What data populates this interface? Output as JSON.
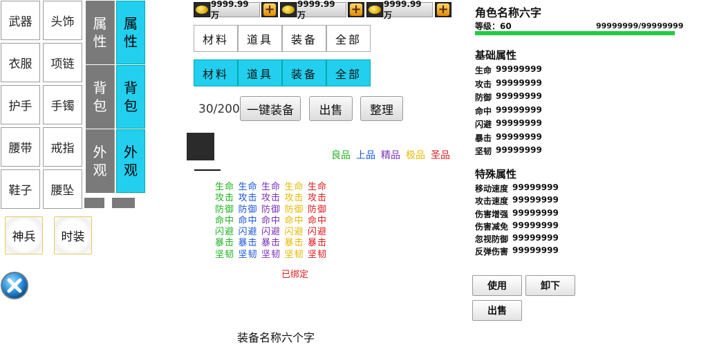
{
  "slots": [
    {
      "name": "weapon",
      "label": "武器"
    },
    {
      "name": "headwear",
      "label": "头饰"
    },
    {
      "name": "clothes",
      "label": "衣服"
    },
    {
      "name": "necklace",
      "label": "项链"
    },
    {
      "name": "wristguard",
      "label": "护手"
    },
    {
      "name": "bracelet",
      "label": "手镯"
    },
    {
      "name": "belt",
      "label": "腰带"
    },
    {
      "name": "ring",
      "label": "戒指"
    },
    {
      "name": "shoes",
      "label": "鞋子"
    },
    {
      "name": "pendant",
      "label": "腰坠"
    }
  ],
  "vtabs_left": [
    "属性",
    "背包",
    "外观"
  ],
  "vtabs_right": [
    "属性",
    "背包",
    "外观"
  ],
  "round_buttons": [
    "神兵",
    "时装"
  ],
  "currency": [
    "9999.99万",
    "9999.99万",
    "9999.99万"
  ],
  "filter_tabs": [
    "材料",
    "道具",
    "装备",
    "全部"
  ],
  "bag": {
    "capacity": "30/200",
    "equip_all": "一键装备",
    "sell": "出售",
    "sort": "整理"
  },
  "qualities": [
    {
      "label": "良品",
      "color": "#1db31d"
    },
    {
      "label": "上品",
      "color": "#1a56e0"
    },
    {
      "label": "精品",
      "color": "#7a2fb8"
    },
    {
      "label": "极品",
      "color": "#e6b800"
    },
    {
      "label": "圣品",
      "color": "#e01a1a"
    }
  ],
  "stat_colors": [
    "#1db31d",
    "#1a56e0",
    "#7a2fb8",
    "#e6b800",
    "#e01a1a"
  ],
  "stat_rows": [
    [
      "生命",
      "生命",
      "生命",
      "生命",
      "生命"
    ],
    [
      "攻击",
      "攻击",
      "攻击",
      "攻击",
      "攻击"
    ],
    [
      "防御",
      "防御",
      "防御",
      "防御",
      "防御"
    ],
    [
      "命中",
      "命中",
      "命中",
      "命中",
      "命中"
    ],
    [
      "闪避",
      "闪避",
      "闪避",
      "闪避",
      "闪避"
    ],
    [
      "暴击",
      "暴击",
      "暴击",
      "暴击",
      "暴击"
    ],
    [
      "坚韧",
      "坚韧",
      "坚韧",
      "坚韧",
      "坚韧"
    ]
  ],
  "bound_text": "已绑定",
  "bound_color": "#e01a1a",
  "equip_name": "装备名称六个字",
  "character": {
    "name": "角色名称六字",
    "level": "等级：60",
    "exp": "99999999/99999999",
    "exp_progress": 1.0,
    "exp_color": "#22cc44",
    "base_title": "基础属性",
    "base": [
      {
        "k": "生命",
        "v": "99999999"
      },
      {
        "k": "攻击",
        "v": "99999999"
      },
      {
        "k": "防御",
        "v": "99999999"
      },
      {
        "k": "命中",
        "v": "99999999"
      },
      {
        "k": "闪避",
        "v": "99999999"
      },
      {
        "k": "暴击",
        "v": "99999999"
      },
      {
        "k": "坚韧",
        "v": "99999999"
      }
    ],
    "special_title": "特殊属性",
    "special": [
      {
        "k": "移动速度",
        "v": "99999999"
      },
      {
        "k": "攻击速度",
        "v": "99999999"
      },
      {
        "k": "伤害增强",
        "v": "99999999"
      },
      {
        "k": "伤害减免",
        "v": "99999999"
      },
      {
        "k": "忽视防御",
        "v": "99999999"
      },
      {
        "k": "反弹伤害",
        "v": "99999999"
      }
    ]
  },
  "actions": {
    "use": "使用",
    "unequip": "卸下",
    "sell": "出售"
  },
  "accent": "#22cfee",
  "close_icon": "close-icon"
}
